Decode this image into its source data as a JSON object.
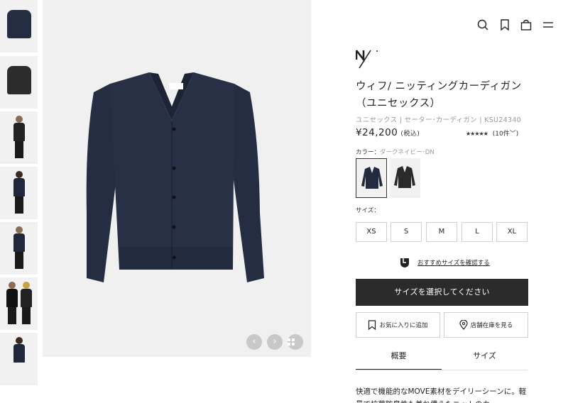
{
  "header": {
    "icons": [
      "search-icon",
      "bookmark-icon",
      "bag-icon",
      "menu-icon"
    ]
  },
  "gallery": {
    "thumbnails": [
      "cardigan-flat-navy",
      "cardigan-flat-black",
      "model-front-black",
      "model-back-navy",
      "model-bag-navy",
      "two-models",
      "model-partial"
    ],
    "controls": {
      "prev": "‹",
      "next": "›",
      "grid": "grid-icon"
    }
  },
  "product": {
    "brand_logo": "N.",
    "title": "ウィフ/ ニッティングカーディガン（ユニセックス）",
    "meta": "ユニセックス | セーター･カーディガン | KSU24340",
    "price": "¥24,200",
    "tax_label": "(税込)",
    "stars": "★★★★★",
    "review_count": "(10件",
    "color_label": "カラー：",
    "color_value": "ダークネイビー･DN",
    "colors": [
      {
        "name": "dark-navy",
        "hex": "#222a3d"
      },
      {
        "name": "black",
        "hex": "#2a2a2a"
      }
    ],
    "size_label": "サイズ：",
    "sizes": [
      "XS",
      "S",
      "M",
      "L",
      "XL"
    ],
    "size_recommend_link": "おすすめサイズを確認する",
    "select_size_button": "サイズを選択してください",
    "favorite_button": "お気に入りに追加",
    "store_stock_button": "店舗在庫を見る",
    "tabs": [
      "概要",
      "サイズ"
    ],
    "description": "快適で機能的なMOVE素材をデイリーシーンに。軽量で抗菌防臭性も兼ね備えたニットのカ"
  },
  "colors": {
    "accent": "#2b2b2b",
    "navy": "#222a3d"
  }
}
